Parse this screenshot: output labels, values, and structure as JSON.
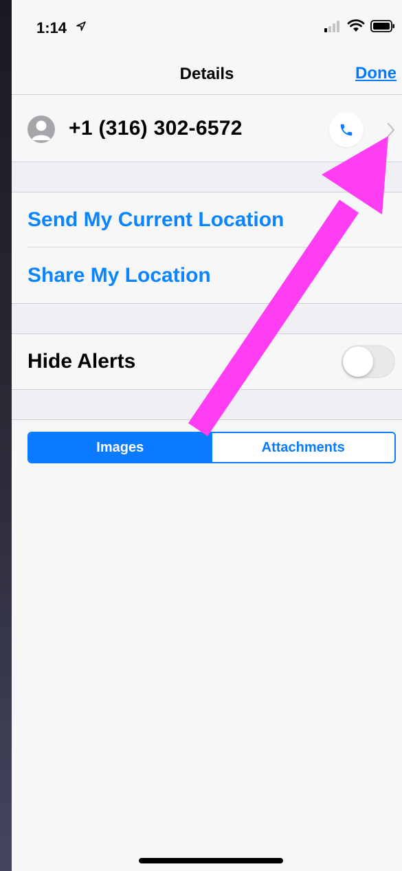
{
  "status_bar": {
    "time": "1:14",
    "icons": [
      "location-arrow-icon",
      "signal-icon",
      "wifi-icon",
      "battery-icon"
    ]
  },
  "nav": {
    "title": "Details",
    "done_label": "Done"
  },
  "contact": {
    "phone_number": "+1 (316) 302-6572",
    "icons": [
      "avatar-icon",
      "phone-icon",
      "chevron-right-icon"
    ]
  },
  "location_section": {
    "items": [
      {
        "label": "Send My Current Location"
      },
      {
        "label": "Share My Location"
      }
    ]
  },
  "alerts": {
    "label": "Hide Alerts",
    "toggle_on": false
  },
  "segmented": {
    "tabs": [
      {
        "label": "Images",
        "active": true
      },
      {
        "label": "Attachments",
        "active": false
      }
    ]
  },
  "colors": {
    "accent": "#0a7aff",
    "annotation": "#ff3df2",
    "background": "#f7f7f7"
  }
}
